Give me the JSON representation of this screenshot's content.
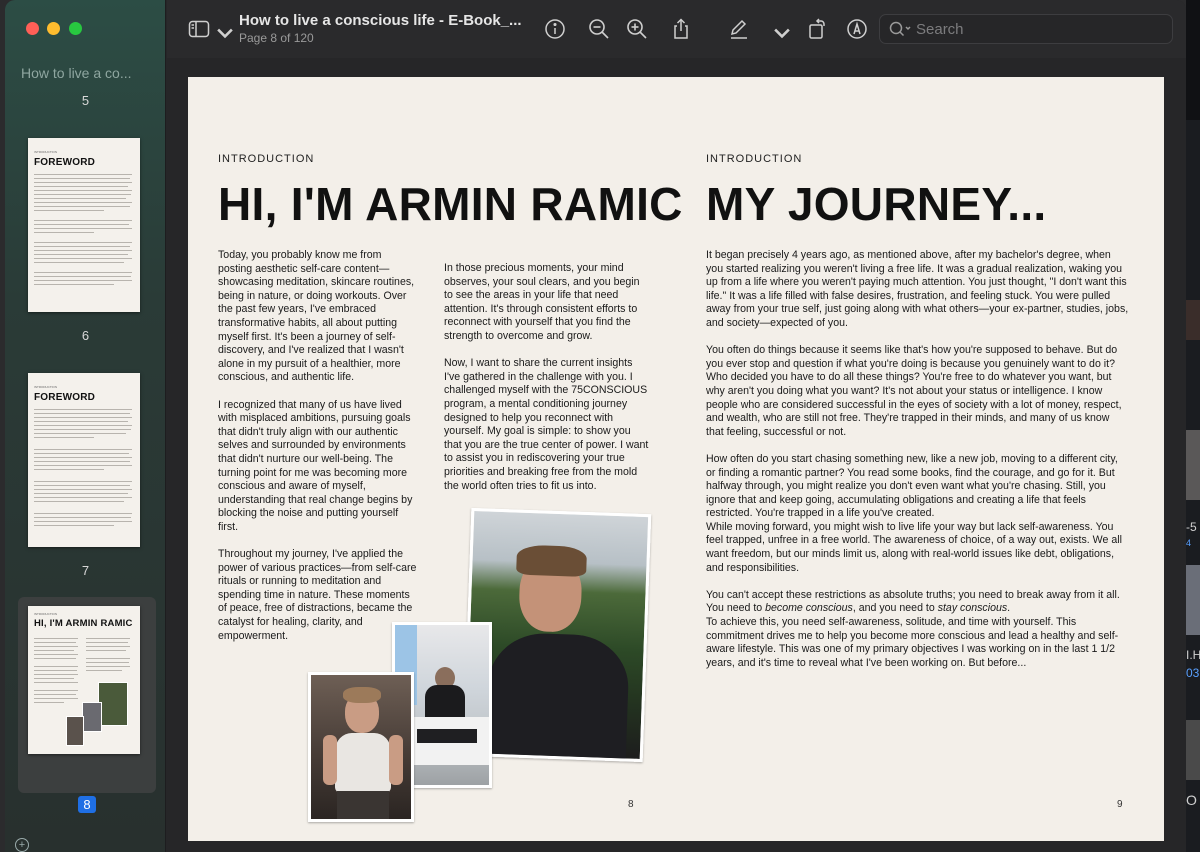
{
  "window": {
    "doc_title": "How to live a conscious life - E-Book_...",
    "page_indicator": "Page 8 of 120"
  },
  "toolbar": {
    "icons": [
      "sidebar-toggle-icon",
      "chevron-down-icon",
      "info-icon",
      "zoom-out-icon",
      "zoom-in-icon",
      "share-icon",
      "markup-pen-icon",
      "chevron-down-icon",
      "rotate-icon",
      "annotate-icon",
      "search-icon"
    ],
    "search_placeholder": "Search"
  },
  "sidebar": {
    "doc_title": "How to live a co...",
    "thumbnails": [
      {
        "page_label": "5"
      },
      {
        "page_label": "6",
        "heading": "FOREWORD",
        "kicker": "INTRODUCTION"
      },
      {
        "page_label": "7",
        "heading": "FOREWORD",
        "kicker": "INTRODUCTION"
      },
      {
        "page_label": "8",
        "heading": "HI, I'M ARMIN RAMIC",
        "kicker": "INTRODUCTION",
        "selected": true
      }
    ]
  },
  "pages": {
    "left": {
      "kicker": "INTRODUCTION",
      "heading": "HI, I'M ARMIN RAMIC",
      "col1": [
        "Today, you probably know me from posting aesthetic self-care content—showcasing meditation, skincare routines, being in nature, or doing workouts. Over the past few years, I've embraced transformative habits, all about putting myself first. It's been a journey of self-discovery, and I've realized that I wasn't alone in my pursuit of a healthier, more conscious, and authentic life.",
        "I recognized that many of us have lived with misplaced ambitions, pursuing goals that didn't truly align with our authentic selves and surrounded by environments that didn't nurture our well-being. The turning point for me was becoming more conscious and aware of myself, understanding that real change begins by blocking the noise and putting yourself first.",
        "Throughout my journey, I've applied the power of various practices—from self-care rituals or running to meditation and spending time in nature. These moments of peace, free of distractions, became the catalyst for healing, clarity, and empowerment."
      ],
      "col2": [
        "In those precious moments, your mind observes, your soul clears, and you begin to see the areas in your life that need attention. It's through consistent efforts to reconnect with yourself that you find the strength to overcome and grow.",
        "Now, I want to share the current insights I've gathered in the challenge with you. I challenged myself with the 75CONSCIOUS program, a mental conditioning journey designed to help you reconnect with yourself. My goal is simple: to show you that you are the true center of power. I want to assist you in rediscovering your true priorities and breaking free from the mold the world often tries to fit us into."
      ],
      "page_number": "8"
    },
    "right": {
      "kicker": "INTRODUCTION",
      "heading": "MY JOURNEY...",
      "paragraphs": [
        "It began precisely 4 years ago, as mentioned above, after my bachelor's degree, when you started realizing you weren't living a free life. It was a gradual realization, waking you up from a life where you weren't paying much attention. You just thought, \"I don't want this life.\" It was a life filled with false desires, frustration, and feeling stuck. You were pulled away from your true self, just going along with what others—your ex-partner, studies, jobs, and society—expected of you.",
        "You often do things because it seems like that's how you're supposed to behave. But do you ever stop and question if what you're doing is because you genuinely want to do it? Who decided you have to do all these things? You're free to do whatever you want, but why aren't you doing what you want? It's not about your status or intelligence. I know people who are considered successful in the eyes of society with a lot of money, respect, and wealth, who are still not free. They're trapped in their minds, and many of us know that feeling, successful or not.",
        "How often do you start chasing something new, like a new job, moving to a different city, or finding a romantic partner? You read some books, find the courage, and go for it. But halfway through, you might realize you don't even want what you're chasing. Still, you ignore that and keep going, accumulating obligations and creating a life that feels restricted. You're trapped in a life you've created.",
        "While moving forward, you might wish to live life your way but lack self-awareness. You feel trapped, unfree in a free world. The awareness of choice, of a way out, exists. We all want freedom, but our minds limit us, along with real-world issues like debt, obligations, and responsibilities."
      ],
      "p5_a": "You can't accept these restrictions as absolute truths; you need to break away from it all. You need to ",
      "p5_em1": "become conscious",
      "p5_b": ", and you need to ",
      "p5_em2": "stay conscious",
      "p5_c": ".",
      "p6": "To achieve this, you need self-awareness, solitude, and time with yourself. This commitment drives me to help you become more conscious and lead a healthy and self-aware lifestyle. This was one of my primary objectives I was working on in the last 1 1/2 years, and it's time to reveal what I've been working on. But before...",
      "page_number": "9"
    }
  },
  "desktop_edge": {
    "fragments": [
      "-5",
      "4",
      "I.H",
      "03",
      "O"
    ]
  }
}
